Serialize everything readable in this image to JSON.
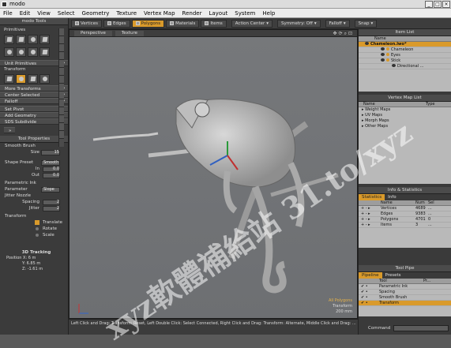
{
  "window": {
    "title": "modo"
  },
  "menu": [
    "File",
    "Edit",
    "View",
    "Select",
    "Geometry",
    "Texture",
    "Vertex Map",
    "Render",
    "Layout",
    "System",
    "Help"
  ],
  "toolbar": {
    "modes": [
      {
        "label": "Vertices",
        "on": false
      },
      {
        "label": "Edges",
        "on": false
      },
      {
        "label": "Polygons",
        "on": true
      },
      {
        "label": "Materials",
        "on": false
      },
      {
        "label": "Items",
        "on": false
      }
    ],
    "action_center": "Action Center",
    "symmetry": "Symmetry: Off",
    "falloff": "Falloff",
    "snap": "Snap"
  },
  "left": {
    "modo_tools": "modo Tools",
    "primitives": "Primitives",
    "unit_primitives": "Unit Primitives",
    "transform": "Transform",
    "more_transforms": "More Transforms",
    "center_selected": "Center Selected",
    "falloff": "Falloff",
    "set_pivot": "Set Pivot",
    "add_geometry": "Add Geometry",
    "sds_subdivide": "SDS Subdivide",
    "tool_properties": "Tool Properties",
    "smooth_brush": "Smooth Brush",
    "size_label": "Size",
    "size_value": "15",
    "shape_preset_label": "Shape Preset",
    "shape_preset_value": "Smooth",
    "in_label": "In",
    "in_value": "0.0",
    "out_label": "Out",
    "out_value": "0.0",
    "parametric_ink": "Parametric Ink",
    "parameter_label": "Parameter",
    "parameter_value": "Slope",
    "jitter_nozzle": "Jitter Nozzle",
    "spacing_label": "Spacing",
    "spacing_value": "2",
    "jitter_label": "Jitter",
    "jitter_value": "2",
    "transform2": "Transform",
    "translate": "Translate",
    "rotate": "Rotate",
    "scale": "Scale",
    "tracking_title": "3D Tracking",
    "pos_x": "Position X:  6 m",
    "pos_y": "Y:  6.85 m",
    "pos_z": "Z:  -1.61 m"
  },
  "viewport": {
    "tab_perspective": "Perspective",
    "tab_texture": "Texture",
    "all_polygons": "All Polygons",
    "transform": "Transform",
    "distance": "200 mm"
  },
  "status": {
    "line1": "Left Click and Drag: Transform: Reset,  Left Double Click: Select Connected,  Right Click and Drag: Transform: Alternate,  Middle Click and Drag: ..."
  },
  "right": {
    "item_list": "Item List",
    "name_col": "Name",
    "items": [
      {
        "label": "Chameleon.lwo*",
        "sel": true
      },
      {
        "label": "Chameleon",
        "sel": false
      },
      {
        "label": "Eyes",
        "sel": false
      },
      {
        "label": "Stick",
        "sel": false
      },
      {
        "label": "Directional ...",
        "sel": false
      }
    ],
    "vertex_map_list": "Vertex Map List",
    "vm_name": "Name",
    "vm_type": "Type",
    "vmaps": [
      "Weight Maps",
      "UV Maps",
      "Morph Maps",
      "Other Maps"
    ],
    "info_stats": "Info & Statistics",
    "tab_statistics": "Statistics",
    "tab_info": "Info",
    "st_name": "Name",
    "st_num": "Num",
    "st_sel": "Sel",
    "stats": [
      {
        "name": "Vertices",
        "num": "4689",
        "sel": "..."
      },
      {
        "name": "Edges",
        "num": "9383",
        "sel": "..."
      },
      {
        "name": "Polygons",
        "num": "4701",
        "sel": "0"
      },
      {
        "name": "Items",
        "num": "3",
        "sel": "..."
      }
    ],
    "tool_pipe": "Tool Pipe",
    "tab_pipeline": "Pipeline",
    "tab_presets": "Presets",
    "tp_tool": "Tool",
    "tp_pr": "Pr...",
    "pipe": [
      {
        "name": "Parametric Ink",
        "sel": false
      },
      {
        "name": "Spacing",
        "sel": false
      },
      {
        "name": "Smooth Brush",
        "sel": false
      },
      {
        "name": "Transform",
        "sel": true
      }
    ],
    "command": "Command"
  },
  "watermark": {
    "line1": "xyz軟體補給站 31.to/xyz"
  }
}
